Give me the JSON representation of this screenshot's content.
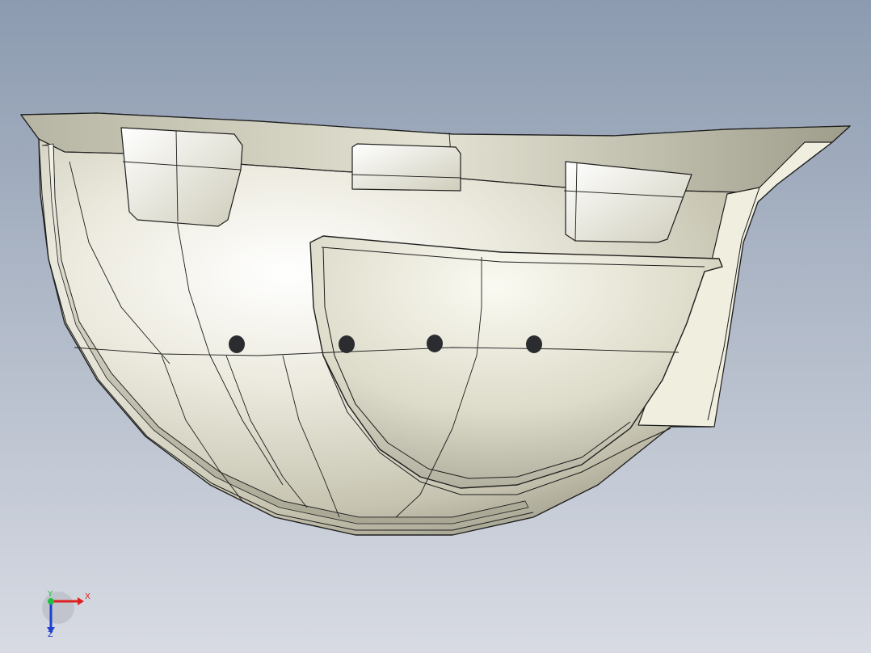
{
  "viewport": {
    "background_top": "#8c9bb0",
    "background_bottom": "#d8dbe3"
  },
  "model": {
    "shell_color": "#e8e6d4",
    "edge_color": "#1e1e1e",
    "hole_color": "#2a2c30"
  },
  "triad": {
    "x_label": "X",
    "y_label": "Y",
    "z_label": "Z",
    "x_color": "#e02020",
    "y_color": "#20c040",
    "z_color": "#2040d0"
  }
}
